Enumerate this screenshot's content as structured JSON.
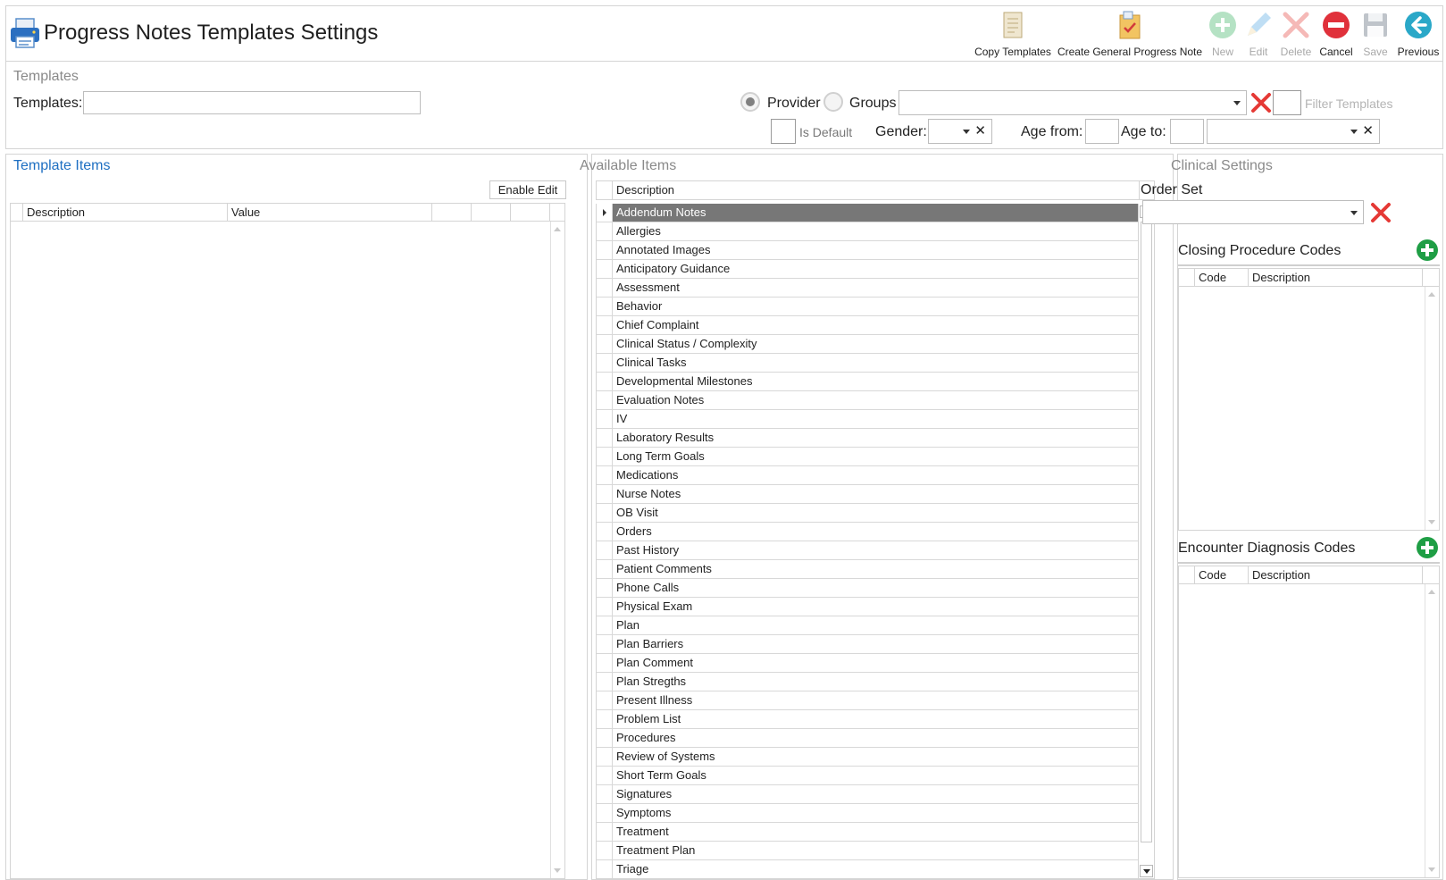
{
  "header": {
    "title": "Progress Notes Templates Settings",
    "toolbar": [
      {
        "label": "Copy Templates",
        "icon": "copy-templates-icon",
        "enabled": true
      },
      {
        "label": "Create General Progress Note",
        "icon": "create-progress-note-icon",
        "enabled": true
      },
      {
        "label": "New",
        "icon": "plus-circle-icon",
        "enabled": false
      },
      {
        "label": "Edit",
        "icon": "pencil-icon",
        "enabled": false
      },
      {
        "label": "Delete",
        "icon": "delete-x-icon",
        "enabled": false
      },
      {
        "label": "Cancel",
        "icon": "cancel-icon",
        "enabled": true
      },
      {
        "label": "Save",
        "icon": "floppy-disk-icon",
        "enabled": false
      },
      {
        "label": "Previous",
        "icon": "arrow-left-icon",
        "enabled": true
      }
    ]
  },
  "templates": {
    "caption": "Templates",
    "templates_label": "Templates:",
    "templates_value": "",
    "provider_label": "Provider",
    "groups_label": "Groups",
    "provider_selected": true,
    "filter_placeholder": "Filter Templates",
    "is_default_label": "Is Default",
    "gender_label": "Gender:",
    "age_from_label": "Age from:",
    "age_to_label": "Age to:"
  },
  "template_items": {
    "caption": "Template Items",
    "enable_edit_label": "Enable Edit",
    "columns": [
      "Description",
      "Value",
      "",
      "",
      ""
    ]
  },
  "available_items": {
    "caption": "Available Items",
    "column": "Description",
    "selected_index": 0,
    "rows": [
      "Addendum Notes",
      "Allergies",
      "Annotated Images",
      "Anticipatory Guidance",
      "Assessment",
      "Behavior",
      "Chief Complaint",
      "Clinical Status / Complexity",
      "Clinical Tasks",
      "Developmental Milestones",
      "Evaluation Notes",
      "IV",
      "Laboratory Results",
      "Long Term Goals",
      "Medications",
      "Nurse Notes",
      "OB Visit",
      "Orders",
      "Past History",
      "Patient Comments",
      "Phone Calls",
      "Physical Exam",
      "Plan",
      "Plan Barriers",
      "Plan Comment",
      "Plan Stregths",
      "Present Illness",
      "Problem List",
      "Procedures",
      "Review of Systems",
      "Short Term Goals",
      "Signatures",
      "Symptoms",
      "Treatment",
      "Treatment Plan",
      "Triage"
    ]
  },
  "clinical_settings": {
    "caption": "Clinical Settings",
    "order_set_label": "Order Set",
    "closing_codes_label": "Closing Procedure Codes",
    "diagnosis_codes_label": "Encounter Diagnosis Codes",
    "code_column": "Code",
    "description_column": "Description"
  },
  "colors": {
    "accent_blue": "#1e6fc2",
    "selected_row": "#777777",
    "delete_red": "#e53935",
    "add_green": "#1f9e45",
    "cancel_red": "#e0313b",
    "previous_teal": "#2aa8c8"
  }
}
